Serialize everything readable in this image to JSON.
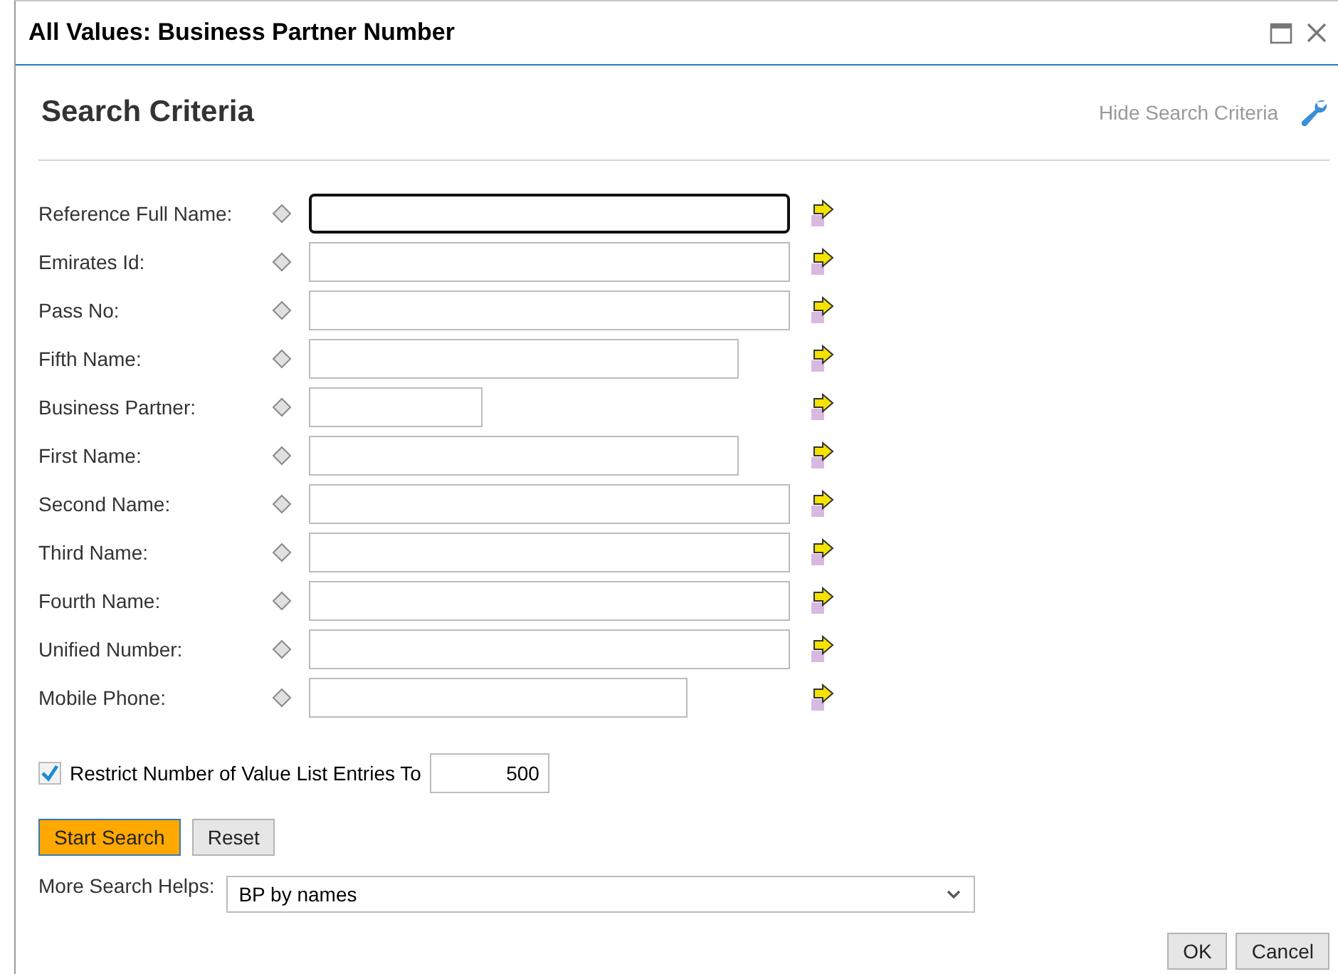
{
  "window": {
    "title": "All Values: Business Partner Number"
  },
  "section": {
    "title": "Search Criteria",
    "toggle": "Hide Search Criteria"
  },
  "fields": [
    {
      "label": "Reference Full Name:",
      "kind": "long",
      "focused": true
    },
    {
      "label": "Emirates Id:",
      "kind": "long",
      "focused": false
    },
    {
      "label": "Pass No:",
      "kind": "long",
      "focused": false
    },
    {
      "label": "Fifth Name:",
      "kind": "medium",
      "focused": false
    },
    {
      "label": "Business Partner:",
      "kind": "short",
      "focused": false
    },
    {
      "label": "First Name:",
      "kind": "medium",
      "focused": false
    },
    {
      "label": "Second Name:",
      "kind": "long",
      "focused": false
    },
    {
      "label": "Third Name:",
      "kind": "long",
      "focused": false
    },
    {
      "label": "Fourth Name:",
      "kind": "long",
      "focused": false
    },
    {
      "label": "Unified Number:",
      "kind": "long",
      "focused": false
    },
    {
      "label": "Mobile Phone:",
      "kind": "small",
      "focused": false
    }
  ],
  "restrict": {
    "label": "Restrict Number of Value List Entries To",
    "checked": true,
    "value": "500"
  },
  "search_buttons": [
    {
      "label": "Start Search",
      "primary": true
    },
    {
      "label": "Reset",
      "primary": false
    }
  ],
  "more_helps": {
    "label": "More Search Helps:",
    "value": "BP by names"
  },
  "footer_buttons": [
    "OK",
    "Cancel"
  ]
}
